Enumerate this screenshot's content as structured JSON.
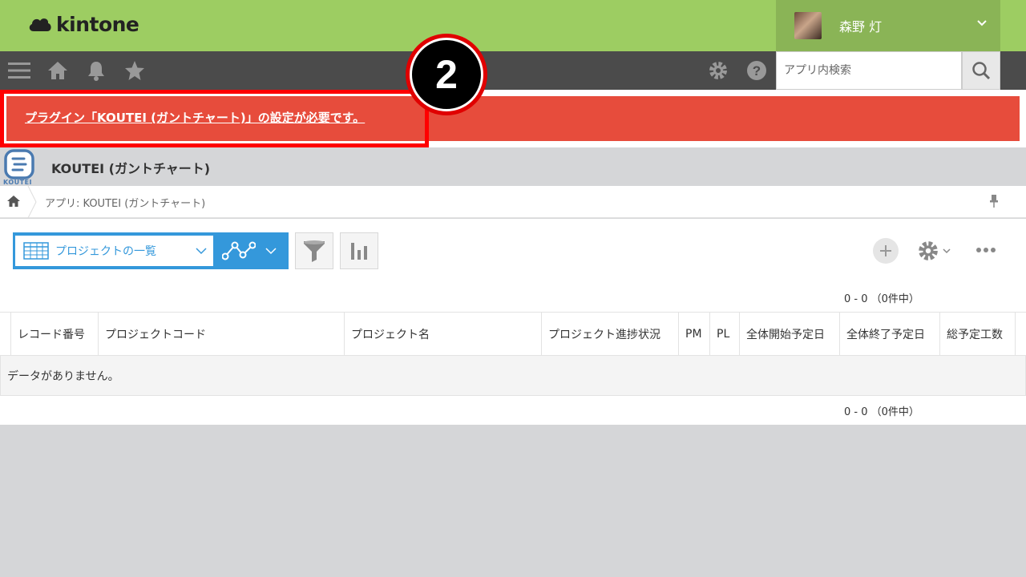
{
  "header": {
    "brand": "kintone",
    "user_name": "森野 灯"
  },
  "navbar": {
    "search_placeholder": "アプリ内検索"
  },
  "alert": {
    "message": "プラグイン「KOUTEI (ガントチャート)」の設定が必要です。"
  },
  "annotation": {
    "step_number": "2"
  },
  "app": {
    "icon_caption": "KOUTEI",
    "title": "KOUTEI (ガントチャート)"
  },
  "breadcrumb": {
    "text": "アプリ: KOUTEI (ガントチャート)"
  },
  "toolbar": {
    "view_label": "プロジェクトの一覧"
  },
  "pager": {
    "top": "0 - 0 （0件中）",
    "bottom": "0 - 0 （0件中）"
  },
  "table": {
    "columns": [
      "レコード番号",
      "プロジェクトコード",
      "プロジェクト名",
      "プロジェクト進捗状況",
      "PM",
      "PL",
      "全体開始予定日",
      "全体終了予定日",
      "総予定工数"
    ],
    "empty_message": "データがありません。"
  },
  "colors": {
    "topbar": "#9dcd62",
    "navbar": "#4b4b4b",
    "alert": "#e74c3c",
    "accent": "#3498db"
  }
}
